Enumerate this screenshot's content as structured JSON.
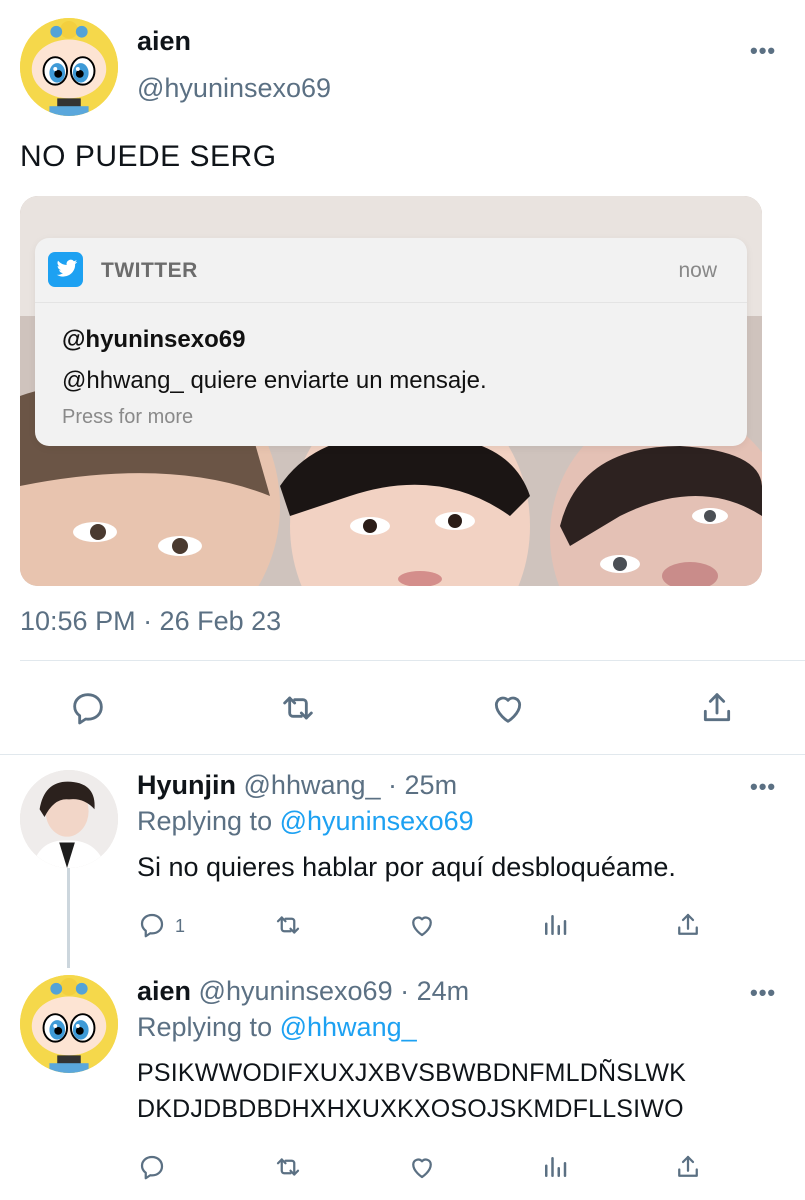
{
  "main_tweet": {
    "display_name": "aien",
    "handle": "@hyuninsexo69",
    "text": "NO PUEDE SERG",
    "timestamp": "10:56 PM · 26 Feb 23",
    "more_icon": "ellipsis-icon",
    "notification": {
      "app_name": "TWITTER",
      "time": "now",
      "title": "@hyuninsexo69",
      "body": "@hhwang_ quiere enviarte un mensaje.",
      "hint": "Press for more"
    },
    "actions": [
      "reply-icon",
      "retweet-icon",
      "like-icon",
      "share-icon"
    ]
  },
  "replies": [
    {
      "display_name": "Hyunjin",
      "handle": "@hhwang_",
      "time": "· 25m",
      "replying_label": "Replying to",
      "replying_to": "@hyuninsexo69",
      "text": "Si no quieres hablar por aquí desbloquéame.",
      "reply_count": "1"
    },
    {
      "display_name": "aien",
      "handle": "@hyuninsexo69",
      "time": "· 24m",
      "replying_label": "Replying to",
      "replying_to": "@hhwang_",
      "text_line1": "PSIKWWODIFXUXJXBVSBWBDNFMLDÑSLWK",
      "text_line2": "DKDJDBDBDHXHXUXKXOSOJSKMDFLLSIWO"
    }
  ],
  "colors": {
    "accent": "#1da1f2",
    "secondary_text": "#5b7083",
    "divider": "#e1e8ed"
  }
}
